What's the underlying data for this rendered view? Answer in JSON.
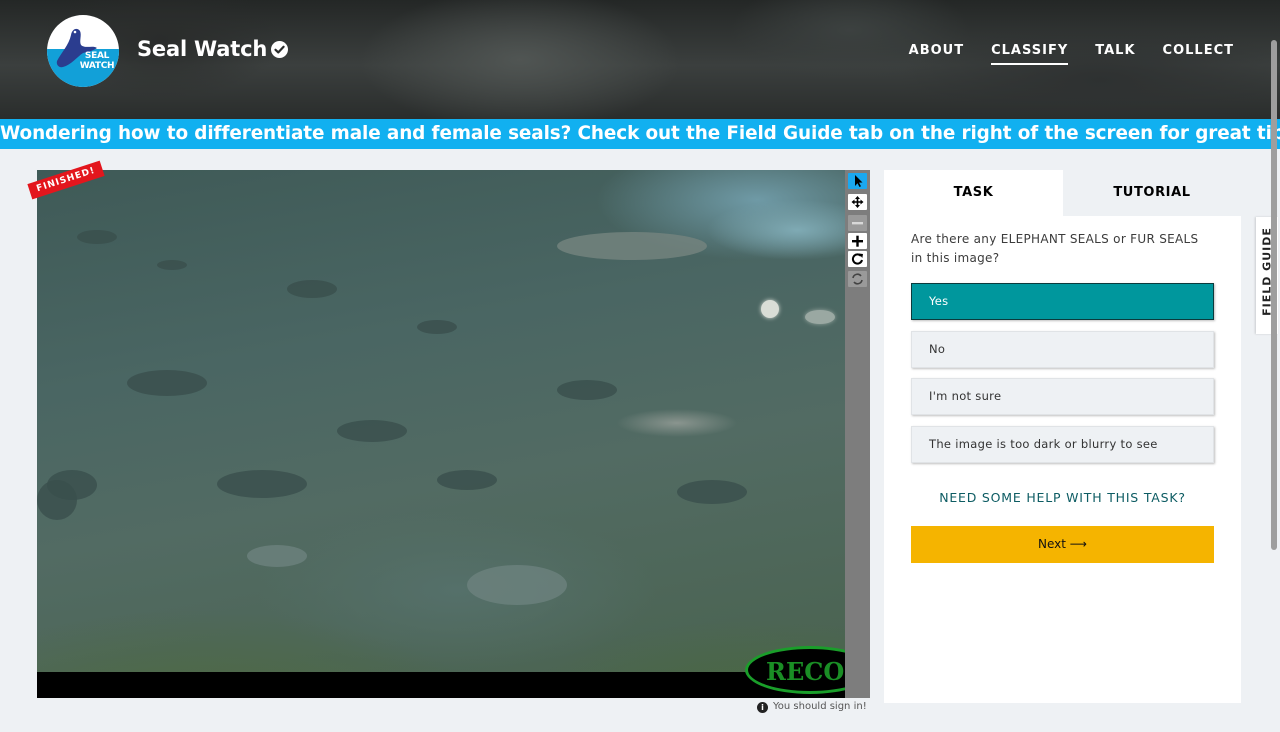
{
  "header": {
    "site_title": "Seal Watch",
    "logo_text_line1": "SEAL",
    "logo_text_line2": "WATCH",
    "nav": [
      {
        "label": "ABOUT",
        "active": false
      },
      {
        "label": "CLASSIFY",
        "active": true
      },
      {
        "label": "TALK",
        "active": false
      },
      {
        "label": "COLLECT",
        "active": false
      }
    ]
  },
  "banner": {
    "text": "Wondering how to differentiate male and female seals? Check out the Field Guide tab on the right of the screen for great tips."
  },
  "viewer": {
    "finished_label": "FINISHED!",
    "camera_brand_overlay": "RECON",
    "toolbar_icons": [
      "pointer-icon",
      "move-icon",
      "zoom-out-icon",
      "zoom-in-icon",
      "rotate-icon",
      "reset-icon"
    ],
    "signin_notice": "You should sign in!"
  },
  "task_panel": {
    "tabs": [
      {
        "label": "TASK",
        "active": true
      },
      {
        "label": "TUTORIAL",
        "active": false
      }
    ],
    "question": "Are there any ELEPHANT SEALS or FUR SEALS in this image?",
    "answers": [
      {
        "label": "Yes",
        "selected": true
      },
      {
        "label": "No",
        "selected": false
      },
      {
        "label": "I'm not sure",
        "selected": false
      },
      {
        "label": "The image is too dark or blurry to see",
        "selected": false
      }
    ],
    "help_link": "NEED SOME HELP WITH THIS TASK?",
    "next_button": "Next ⟶"
  },
  "field_guide": {
    "label": "FIELD GUIDE"
  },
  "colors": {
    "banner": "#11b0f0",
    "selected_answer": "#00979d",
    "next_button": "#f5b400",
    "finished_ribbon": "#e3161d",
    "active_tool": "#1aa8f0"
  }
}
